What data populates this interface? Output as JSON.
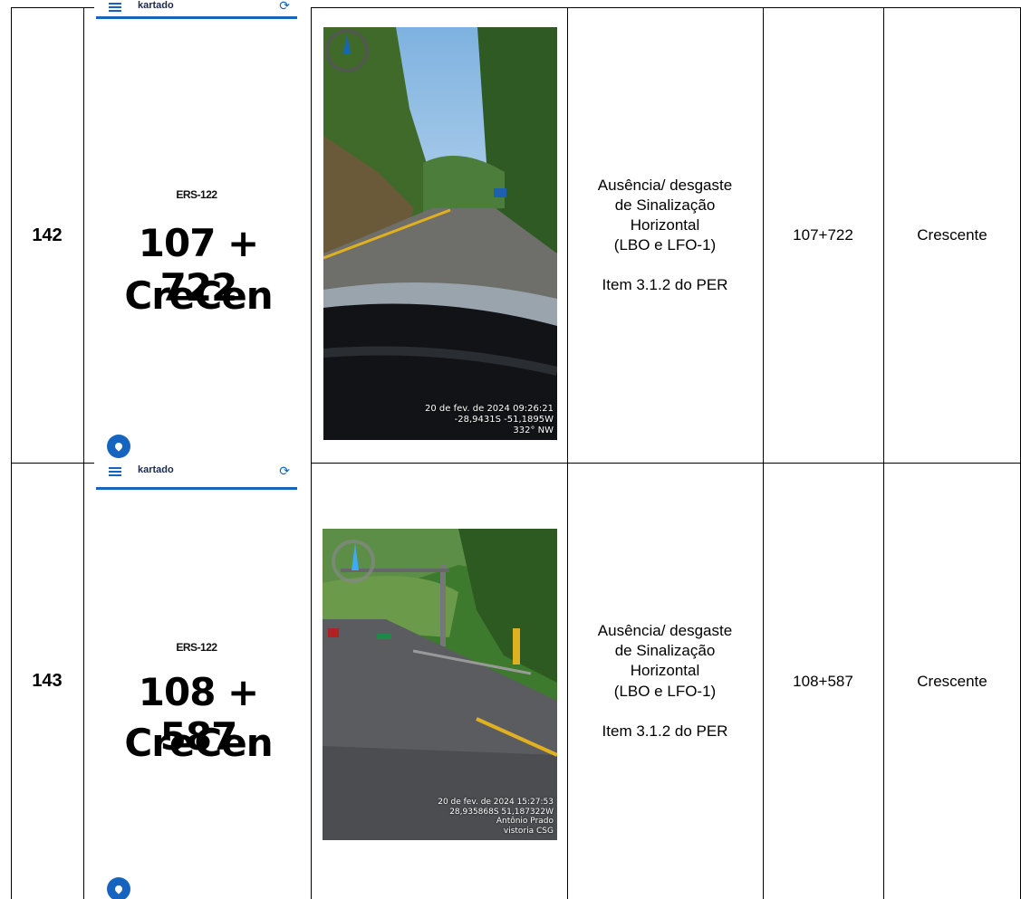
{
  "rows": [
    {
      "number": "142",
      "app": {
        "name": "kartado",
        "road": "ERS-122",
        "km_line1": "107 + 722",
        "km_line2": "CreCen"
      },
      "photo_stamp": [
        "20 de fev. de 2024 09:26:21",
        "-28,9431S -51,1895W",
        "332° NW"
      ],
      "desc": [
        "Ausência/ desgaste",
        "de Sinalização",
        "Horizontal",
        "(LBO e LFO-1)"
      ],
      "ref": "Item 3.1.2 do PER",
      "km": "107+722",
      "direction": "Crescente"
    },
    {
      "number": "143",
      "app": {
        "name": "kartado",
        "road": "ERS-122",
        "km_line1": "108 + 587",
        "km_line2": "CreCen"
      },
      "photo_stamp": [
        "20 de fev. de 2024 15:27:53",
        "28,935868S 51,187322W",
        "Antônio Prado",
        "vistoria CSG"
      ],
      "desc": [
        "Ausência/ desgaste",
        "de Sinalização",
        "Horizontal",
        "(LBO e LFO-1)"
      ],
      "ref": "Item 3.1.2 do PER",
      "km": "108+587",
      "direction": "Crescente"
    }
  ],
  "icons": [
    "menu-icon",
    "sync-icon",
    "location-pin-icon",
    "compass-icon"
  ],
  "colors": {
    "app_accent": "#1565c0"
  }
}
